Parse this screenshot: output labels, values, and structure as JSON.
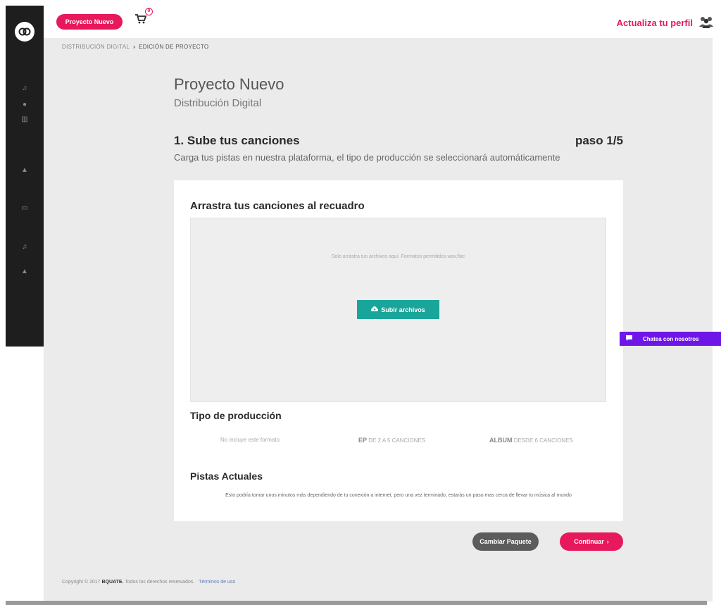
{
  "topbar": {
    "new_project_label": "Proyecto Nuevo",
    "cart_count": "0",
    "update_profile_label": "Actualiza tu perfil"
  },
  "breadcrumb": {
    "root": "DISTRIBUCIÓN DIGITAL",
    "separator": "›",
    "current": "EDICIÓN DE PROYECTO"
  },
  "page": {
    "title": "Proyecto Nuevo",
    "subtitle": "Distribución Digital"
  },
  "step": {
    "title": "1. Sube tus canciones",
    "count": "paso 1/5",
    "description": "Carga tus pistas en nuestra plataforma, el tipo de producción se seleccionará automáticamente"
  },
  "upload": {
    "title": "Arrastra tus canciones al recuadro",
    "hint": "Solo arrastra tus archivos aquí. Formatos permitidos wav,flac",
    "button_label": "Subir archivos"
  },
  "production": {
    "title": "Tipo de producción",
    "options": [
      {
        "strong": "",
        "text": "No incluye este formato"
      },
      {
        "strong": "EP",
        "text": "DE 2 A 5 CANCIONES"
      },
      {
        "strong": "ALBUM",
        "text": "DESDE 6 CANCIONES"
      }
    ]
  },
  "tracks": {
    "title": "Pistas Actuales",
    "description": "Esto podría tomar unos minutos más dependiendo de tu conexión a internet, pero una vez terminado, estarás un paso mas cerca de llevar tu música al mundo"
  },
  "actions": {
    "change_package_label": "Cambiar Paquete",
    "continue_label": "Continuar",
    "continue_arrow": "›"
  },
  "footer": {
    "copyright": "Copyright © 2017",
    "brand": "BQUATE.",
    "rights": "Todos los derechos reservados.",
    "terms": "Términos de uso"
  },
  "chat": {
    "label": "Chatea con nosotros"
  },
  "icons": {
    "logo": "bquate-logo-icon",
    "cart": "cart-icon",
    "profile": "people-icon",
    "upload": "cloud-upload-icon",
    "chat": "chat-bubble-icon"
  },
  "colors": {
    "accent": "#e8185c",
    "teal": "#1aa59a",
    "chat": "#6e16e8",
    "sidebar": "#1e1e1e"
  }
}
